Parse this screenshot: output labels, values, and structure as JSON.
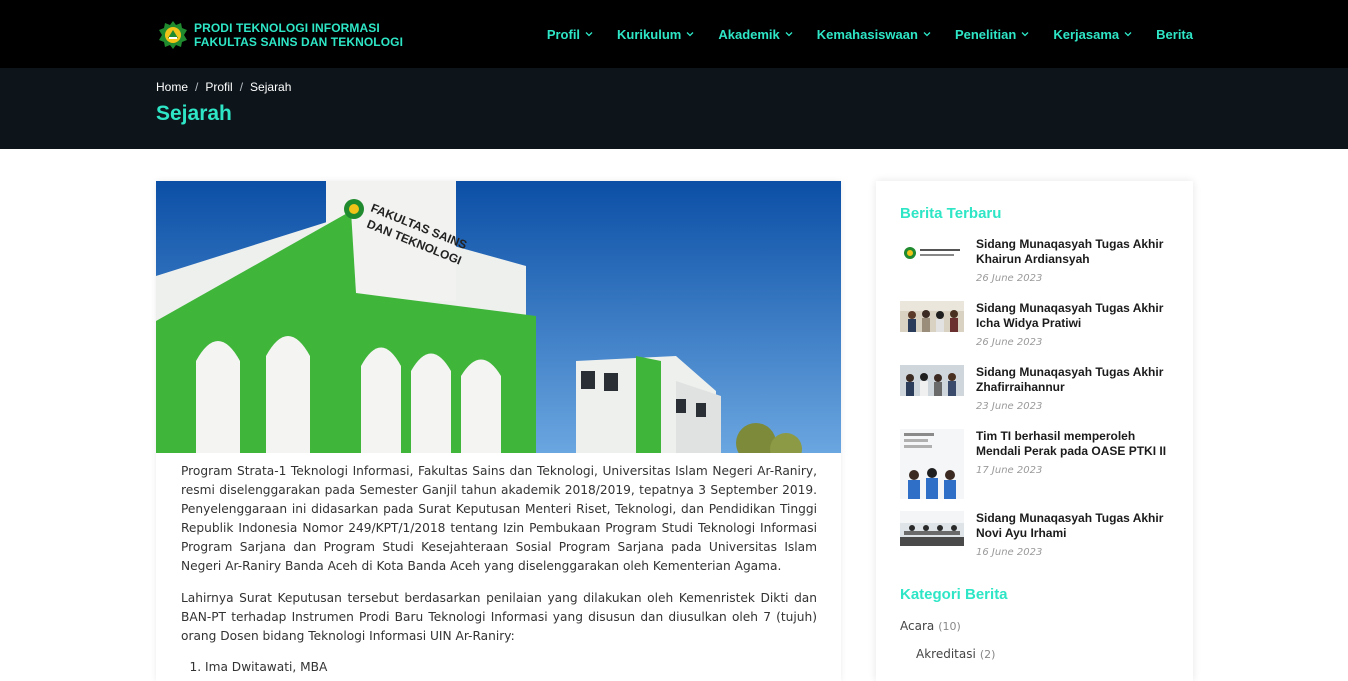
{
  "header": {
    "brand_line1": "PRODI TEKNOLOGI INFORMASI",
    "brand_line2": "FAKULTAS SAINS DAN TEKNOLOGI",
    "nav": [
      {
        "label": "Profil",
        "has_dropdown": true
      },
      {
        "label": "Kurikulum",
        "has_dropdown": true
      },
      {
        "label": "Akademik",
        "has_dropdown": true
      },
      {
        "label": "Kemahasiswaan",
        "has_dropdown": true
      },
      {
        "label": "Penelitian",
        "has_dropdown": true
      },
      {
        "label": "Kerjasama",
        "has_dropdown": true
      },
      {
        "label": "Berita",
        "has_dropdown": false
      }
    ]
  },
  "breadcrumb": {
    "items": [
      "Home",
      "Profil",
      "Sejarah"
    ],
    "separator": "/"
  },
  "page_title": "Sejarah",
  "hero_image": {
    "sign_line1": "FAKULTAS SAINS",
    "sign_line2": "DAN TEKNOLOGI"
  },
  "article": {
    "paragraph1": "Program Strata-1 Teknologi Informasi, Fakultas Sains dan Teknologi, Universitas Islam Negeri Ar-Raniry, resmi diselenggarakan pada Semester Ganjil tahun akademik 2018/2019, tepatnya 3 September 2019. Penyelenggaraan ini didasarkan pada Surat Keputusan Menteri Riset, Teknologi, dan Pendidikan Tinggi Republik Indonesia Nomor 249/KPT/1/2018 tentang Izin Pembukaan Program Studi Teknologi Informasi Program Sarjana dan Program Studi Kesejahteraan Sosial Program Sarjana pada Universitas Islam Negeri Ar-Raniry Banda Aceh di Kota Banda Aceh yang diselenggarakan oleh Kementerian Agama.",
    "paragraph2": "Lahirnya Surat Keputusan tersebut berdasarkan penilaian yang dilakukan oleh Kemenristek Dikti dan BAN-PT terhadap Instrumen Prodi Baru Teknologi Informasi yang disusun dan diusulkan oleh 7 (tujuh) orang Dosen bidang Teknologi Informasi UIN Ar-Raniry:",
    "list": [
      "Ima Dwitawati, MBA"
    ]
  },
  "sidebar": {
    "recent_heading": "Berita Terbaru",
    "recent": [
      {
        "title": "Sidang Munaqasyah Tugas Akhir Khairun Ardiansyah",
        "date": "26 June 2023",
        "thumb": "logo-doc"
      },
      {
        "title": "Sidang Munaqasyah Tugas Akhir Icha Widya Pratiwi",
        "date": "26 June 2023",
        "thumb": "group-photo"
      },
      {
        "title": "Sidang Munaqasyah Tugas Akhir Zhafirraihannur",
        "date": "23 June 2023",
        "thumb": "group-photo"
      },
      {
        "title": "Tim TI berhasil memperoleh Mendali Perak pada OASE PTKI II",
        "date": "17 June 2023",
        "thumb": "medal-poster"
      },
      {
        "title": "Sidang Munaqasyah Tugas Akhir Novi Ayu Irhami",
        "date": "16 June 2023",
        "thumb": "classroom"
      }
    ],
    "category_heading": "Kategori Berita",
    "categories": [
      {
        "label": "Acara",
        "count": "(10)"
      },
      {
        "label": "Akreditasi",
        "count": "(2)"
      }
    ]
  },
  "colors": {
    "accent": "#2ee6c6",
    "header_bg": "#000000",
    "titleband_bg": "#0d151b",
    "building_green": "#3fb53a"
  }
}
